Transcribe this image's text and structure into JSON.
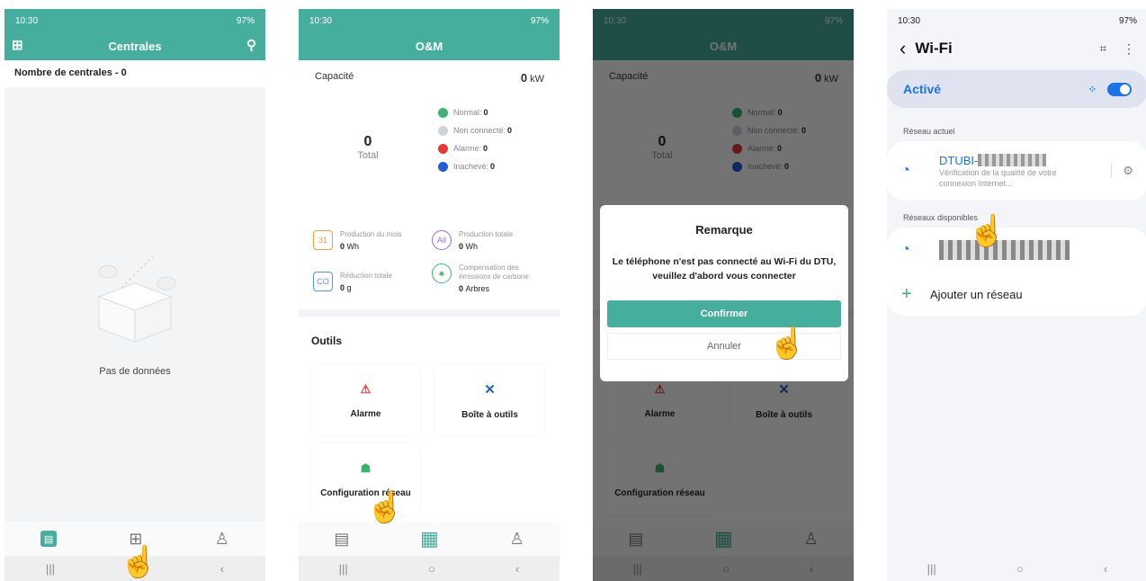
{
  "status": {
    "time": "10:30",
    "battery": "97%"
  },
  "s1": {
    "title": "Centrales",
    "count_label": "Nombre de centrales - 0",
    "empty": "Pas de données"
  },
  "s2": {
    "title": "O&M",
    "capacity_label": "Capacité",
    "capacity_value": "0",
    "capacity_unit": "kW",
    "total_value": "0",
    "total_label": "Total",
    "legend": [
      {
        "label": "Normal:",
        "value": "0",
        "color": "#3cb371"
      },
      {
        "label": "Non connecté:",
        "value": "0",
        "color": "#cfd3d8"
      },
      {
        "label": "Alarme:",
        "value": "0",
        "color": "#e53935"
      },
      {
        "label": "Inachevé:",
        "value": "0",
        "color": "#1e5fd8"
      }
    ],
    "stats": [
      {
        "icon": "31",
        "label": "Production du mois",
        "value": "0",
        "unit": "Wh"
      },
      {
        "icon": "All",
        "label": "Production totale",
        "value": "0",
        "unit": "Wh"
      },
      {
        "icon": "CO",
        "label": "Réduction totale",
        "value": "0",
        "unit": "g"
      },
      {
        "icon": "♣",
        "label": "Compensation des émissions de carbone",
        "value": "0",
        "unit": "Arbres"
      }
    ],
    "tools_title": "Outils",
    "tools": [
      "Alarme",
      "Boîte à outils",
      "Configuration réseau"
    ]
  },
  "s3": {
    "dialog_title": "Remarque",
    "dialog_text": "Le téléphone n'est pas connecté au Wi-Fi du DTU, veuillez d'abord vous connecter",
    "confirm": "Confirmer",
    "cancel": "Annuler"
  },
  "s4": {
    "back": "‹",
    "title": "Wi-Fi",
    "toggle_label": "Activé",
    "current_section": "Réseau actuel",
    "current_name": "DTUBI-",
    "current_status": "Vérification de la qualité de votre connexion Internet...",
    "available_section": "Réseaux disponibles",
    "add_network": "Ajouter un réseau"
  },
  "colors": {
    "teal": "#45ae9c",
    "teal_dark": "#24574e",
    "blue": "#1a73e8"
  }
}
